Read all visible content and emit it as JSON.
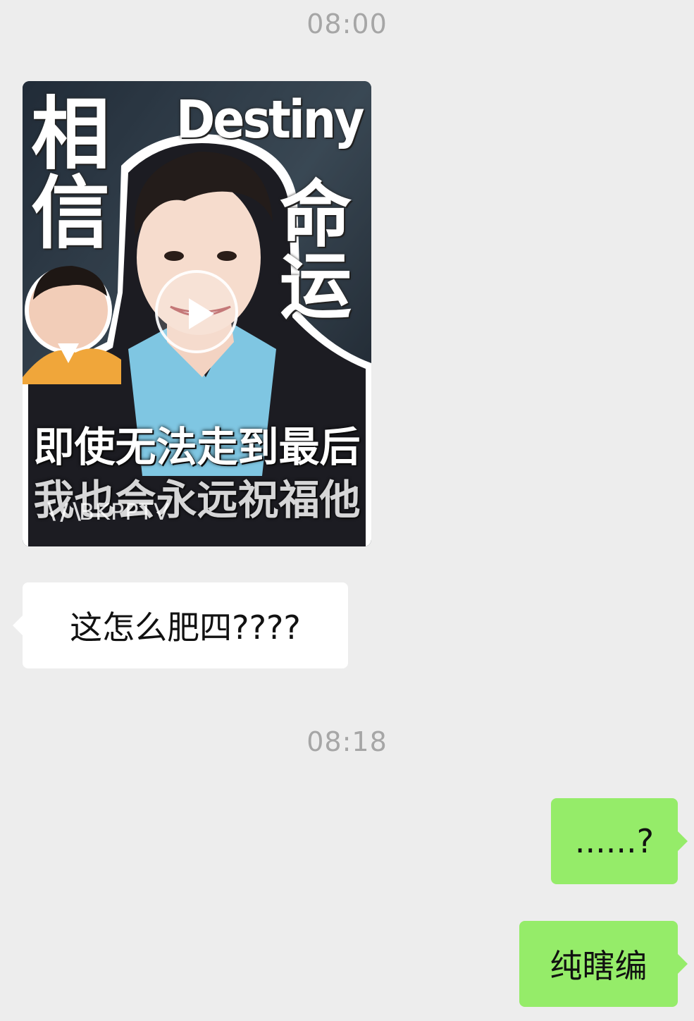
{
  "timestamps": [
    "08:00",
    "08:18"
  ],
  "video_card": {
    "title_left": "相信",
    "title_right": "命运",
    "title_en": "Destiny",
    "caption_line1": "即使无法走到最后",
    "caption_line2": "我也会永远祝福他",
    "watermark": "BKPPTV",
    "play_icon": "play-icon"
  },
  "messages": [
    {
      "side": "incoming",
      "text": "这怎么肥四????"
    },
    {
      "side": "outgoing",
      "text": "......?"
    },
    {
      "side": "outgoing",
      "text": "纯瞎编"
    }
  ],
  "colors": {
    "background": "#ededed",
    "incoming_bubble": "#ffffff",
    "outgoing_bubble": "#95ec69",
    "timestamp": "#a6a6a6"
  }
}
